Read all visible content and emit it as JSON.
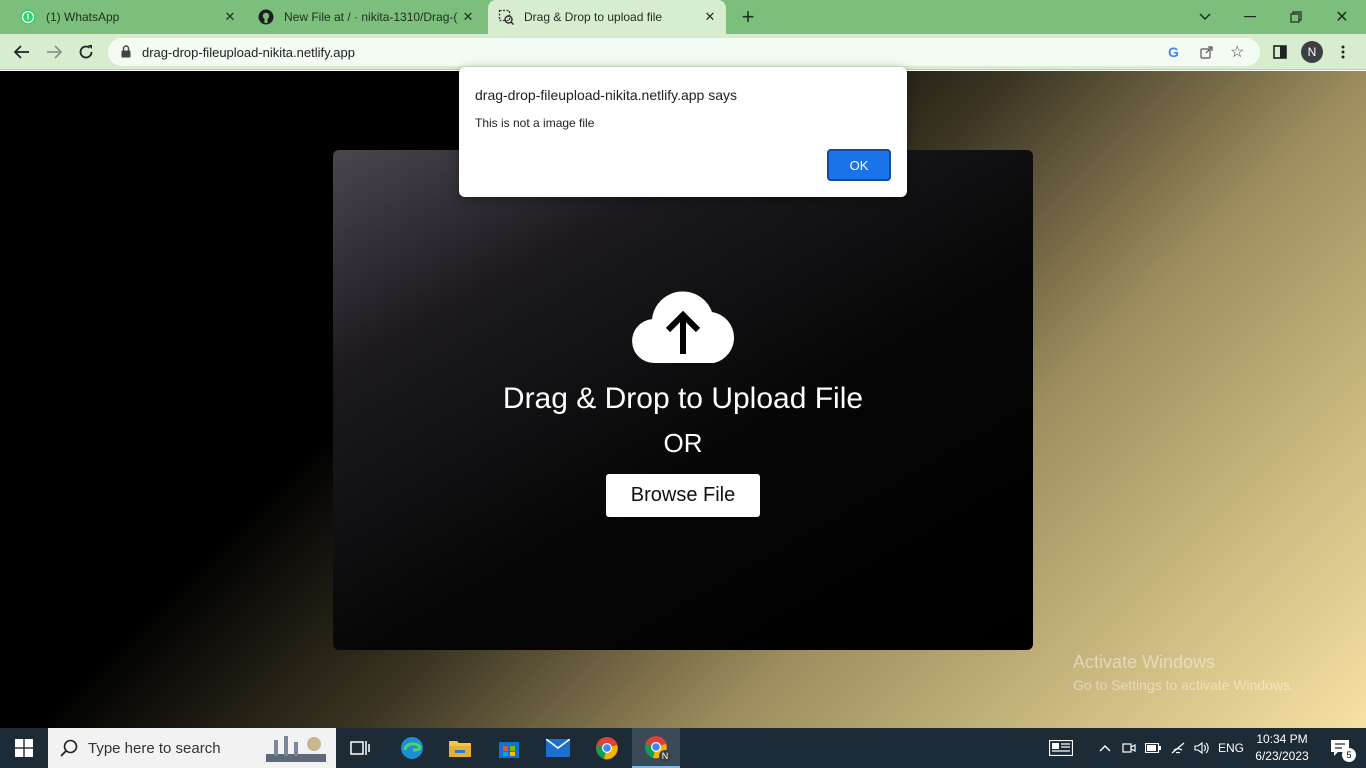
{
  "browser": {
    "tabs": [
      {
        "title": "(1) WhatsApp",
        "icon": "whatsapp-icon"
      },
      {
        "title": "New File at / · nikita-1310/Drag-(",
        "icon": "github-icon"
      },
      {
        "title": "Drag & Drop to upload file",
        "icon": "page-icon"
      }
    ],
    "url": "drag-drop-fileupload-nikita.netlify.app",
    "profile_initial": "N",
    "colors": {
      "frame": "#7cbf7c",
      "toolbar": "#d8eccf"
    }
  },
  "dialog": {
    "title": "drag-drop-fileupload-nikita.netlify.app says",
    "message": "This is not a image file",
    "ok_label": "OK"
  },
  "page": {
    "heading": "Drag & Drop to Upload File",
    "or_text": "OR",
    "browse_label": "Browse File"
  },
  "watermark": {
    "line1": "Activate Windows",
    "line2": "Go to Settings to activate Windows."
  },
  "taskbar": {
    "search_placeholder": "Type here to search",
    "language": "ENG",
    "time": "10:34 PM",
    "date": "6/23/2023",
    "notification_count": "5",
    "chrome_badge": "N"
  }
}
